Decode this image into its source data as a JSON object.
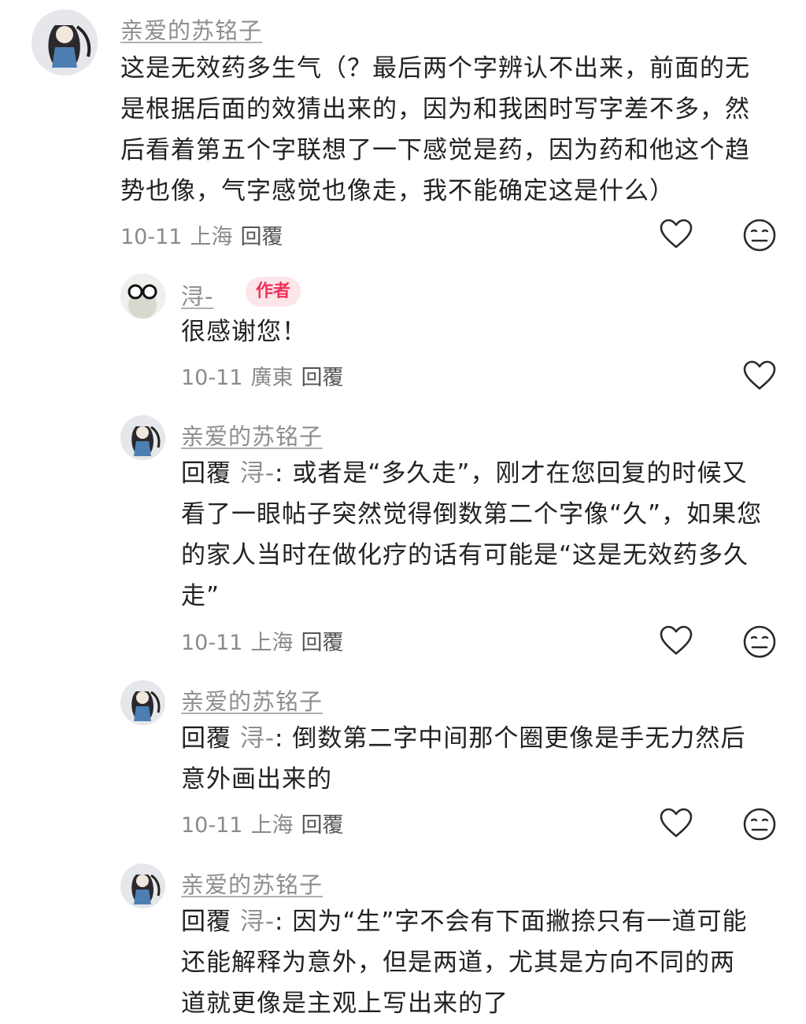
{
  "comments": [
    {
      "username": "亲爱的苏铭子",
      "lines": [
        "这是无效药多生气（？最后两个字辨认不出来，前面的无",
        "是根据后面的效猜出来的，因为和我困时写字差不多，然",
        "后看着第五个字联想了一下感觉是药，因为药和他这个趋",
        "势也像，气字感觉也像走，我不能确定这是什么）"
      ],
      "date": "10-11",
      "location": "上海",
      "reply_label": "回覆"
    },
    {
      "username": "浔-",
      "badge": "作者",
      "lines": [
        "很感谢您！"
      ],
      "date": "10-11",
      "location": "廣東",
      "reply_label": "回覆"
    },
    {
      "username": "亲爱的苏铭子",
      "reply_prefix": "回覆",
      "reply_target": "浔-",
      "first_line": ": 或者是“多久走”，刚才在您回复的时候又",
      "lines": [
        "看了一眼帖子突然觉得倒数第二个字像“久”，如果您",
        "的家人当时在做化疗的话有可能是“这是无效药多久",
        "走”"
      ],
      "date": "10-11",
      "location": "上海",
      "reply_label": "回覆"
    },
    {
      "username": "亲爱的苏铭子",
      "reply_prefix": "回覆",
      "reply_target": "浔-",
      "first_line": ": 倒数第二字中间那个圈更像是手无力然后",
      "lines": [
        "意外画出来的"
      ],
      "date": "10-11",
      "location": "上海",
      "reply_label": "回覆"
    },
    {
      "username": "亲爱的苏铭子",
      "reply_prefix": "回覆",
      "reply_target": "浔-",
      "first_line": ": 因为“生”字不会有下面撇捺只有一道可能",
      "lines": [
        "还能解释为意外，但是两道，尤其是方向不同的两",
        "道就更像是主观上写出来的了"
      ]
    }
  ]
}
